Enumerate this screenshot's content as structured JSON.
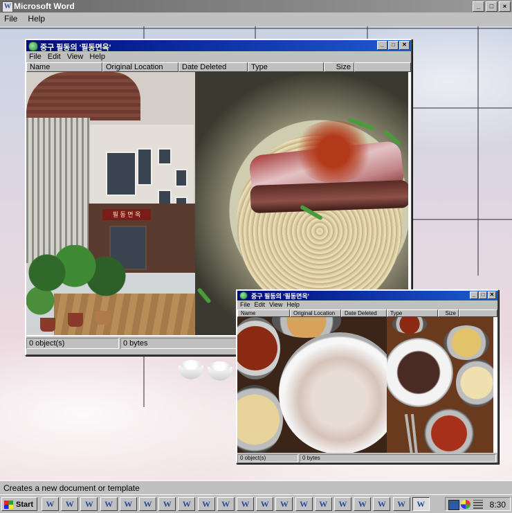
{
  "app": {
    "title": "Microsoft Word",
    "logo_glyph": "W",
    "menu": [
      "File",
      "Help"
    ],
    "title_buttons": [
      "_",
      "□",
      "×"
    ]
  },
  "windows": [
    {
      "title": "중구 필동의 '필동면옥'",
      "menu": [
        "File",
        "Edit",
        "View",
        "Help"
      ],
      "columns": [
        "Name",
        "Original Location",
        "Date Deleted",
        "Type",
        "Size"
      ],
      "status": [
        "0 object(s)",
        "0 bytes"
      ],
      "images": [
        "building-photo",
        "naengmyeon-photo"
      ],
      "sign_text": "필 동 면 옥"
    },
    {
      "title": "중구 필동의 '필동면옥'",
      "menu": [
        "File",
        "Edit",
        "View",
        "Help"
      ],
      "columns": [
        "Name",
        "Original Location",
        "Date Deleted",
        "Type",
        "Size"
      ],
      "status": [
        "0 object(s)",
        "0 bytes"
      ],
      "images": [
        "suyuk-photo",
        "beef-side-dishes-photo"
      ]
    }
  ],
  "decor": {
    "rice_bowls": 2,
    "icon": "rice-bowl-icon"
  },
  "statusbar": {
    "text": "Creates a new document or template"
  },
  "taskbar": {
    "start_label": "Start",
    "task_glyph": "W",
    "task_count": 20,
    "clock": "8:30",
    "colors": {
      "title_active": "#000a7a",
      "title_gradient_end": "#1d5bd0",
      "face": "#c0c0c0"
    }
  }
}
